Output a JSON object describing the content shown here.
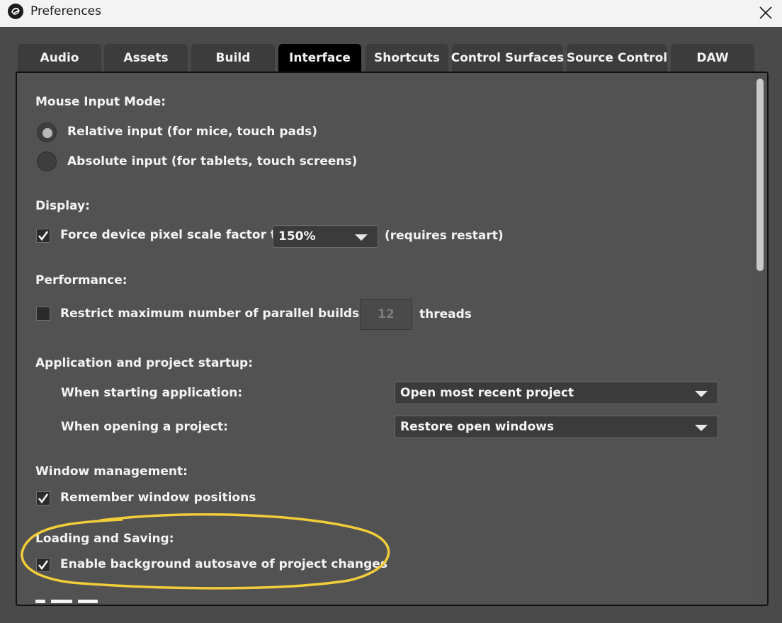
{
  "window": {
    "title": "Preferences",
    "logo_icon": "app-logo-icon",
    "close_icon": "close-icon"
  },
  "tabs": [
    {
      "label": "Audio",
      "active": false
    },
    {
      "label": "Assets",
      "active": false
    },
    {
      "label": "Build",
      "active": false
    },
    {
      "label": "Interface",
      "active": true
    },
    {
      "label": "Shortcuts",
      "active": false
    },
    {
      "label": "Control Surfaces",
      "active": false
    },
    {
      "label": "Source Control",
      "active": false
    },
    {
      "label": "DAW",
      "active": false
    }
  ],
  "mouse_input": {
    "heading": "Mouse Input Mode:",
    "options": [
      {
        "label": "Relative input (for mice, touch pads)",
        "selected": true
      },
      {
        "label": "Absolute input (for tablets, touch screens)",
        "selected": false
      }
    ]
  },
  "display": {
    "heading": "Display:",
    "force_scale_label": "Force device pixel scale factor to",
    "force_scale_checked": true,
    "scale_value": "150%",
    "restart_note": "(requires restart)"
  },
  "performance": {
    "heading": "Performance:",
    "restrict_label": "Restrict maximum number of parallel builds to",
    "restrict_checked": false,
    "threads_value": "12",
    "threads_suffix": "threads"
  },
  "startup": {
    "heading": "Application and project startup:",
    "starting_label": "When starting application:",
    "starting_value": "Open most recent project",
    "opening_label": "When opening a project:",
    "opening_value": "Restore open windows"
  },
  "window_management": {
    "heading": "Window management:",
    "remember_label": "Remember window positions",
    "remember_checked": true
  },
  "loading_saving": {
    "heading": "Loading and Saving:",
    "autosave_label": "Enable background autosave of project changes",
    "autosave_checked": true
  },
  "annotation": {
    "highlight_color": "#f2cd3a"
  },
  "colors": {
    "panel_bg": "#525252",
    "tab_bg": "#3c3c3c",
    "tab_active_bg": "#000000",
    "text": "#f4f4f4"
  }
}
